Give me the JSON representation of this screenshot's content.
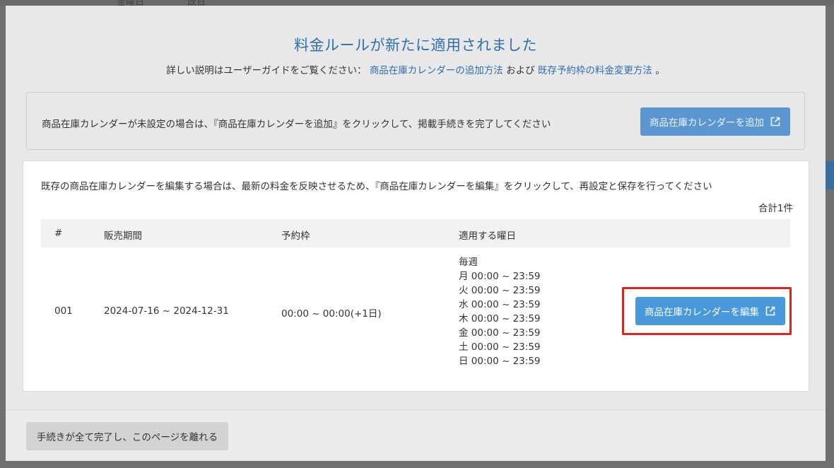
{
  "background": {
    "top_labels": [
      "金曜日",
      "既日"
    ]
  },
  "modal": {
    "title": "料金ルールが新たに適用されました",
    "subtitle_prefix": "詳しい説明はユーザーガイドをご覧ください：",
    "subtitle_link1": "商品在庫カレンダーの追加方法",
    "subtitle_and": "および",
    "subtitle_link2": "既存予約枠の料金変更方法",
    "subtitle_suffix": "。"
  },
  "add_section": {
    "text": "商品在庫カレンダーが未設定の場合は、『商品在庫カレンダーを追加』をクリックして、掲載手続きを完了してください",
    "button_label": "商品在庫カレンダーを追加",
    "button_icon": "external-link-icon"
  },
  "edit_section": {
    "text": "既存の商品在庫カレンダーを編集する場合は、最新の料金を反映させるため、『商品在庫カレンダーを編集』をクリックして、再設定と保存を行ってください",
    "count": "合計1件",
    "columns": [
      "#",
      "販売期間",
      "予約枠",
      "適用する曜日"
    ],
    "rows": [
      {
        "id": "001",
        "period": "2024-07-16 ~ 2024-12-31",
        "slot": "00:00 ~ 00:00(+1日)",
        "days_header": "毎週",
        "days": [
          "月 00:00 ~ 23:59",
          "火 00:00 ~ 23:59",
          "水 00:00 ~ 23:59",
          "木 00:00 ~ 23:59",
          "金 00:00 ~ 23:59",
          "土 00:00 ~ 23:59",
          "日 00:00 ~ 23:59"
        ],
        "button_label": "商品在庫カレンダーを編集",
        "button_icon": "external-link-icon"
      }
    ]
  },
  "footer": {
    "button_label": "手続きが全て完了し、このページを離れる"
  },
  "colors": {
    "accent": "#2f6fb0",
    "button_blue": "#4a98dc",
    "highlight_red": "#d9261c"
  }
}
